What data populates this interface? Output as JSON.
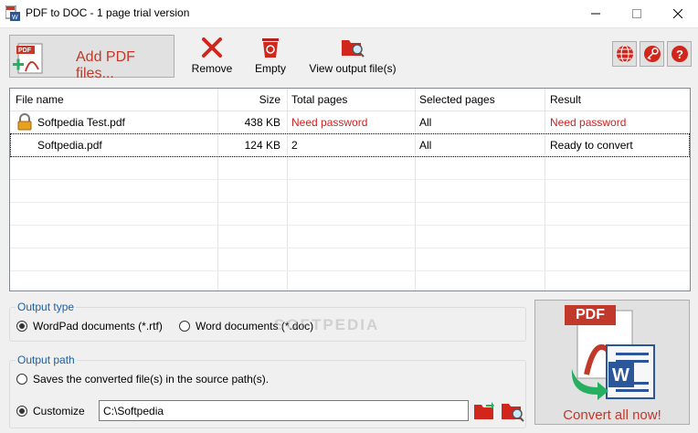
{
  "window": {
    "title": "PDF to DOC - 1 page trial version"
  },
  "toolbar": {
    "add_label": "Add PDF files...",
    "remove_label": "Remove",
    "empty_label": "Empty",
    "view_label": "View output file(s)",
    "small_buttons": [
      "globe-icon",
      "key-icon",
      "help-icon"
    ]
  },
  "table": {
    "columns": [
      "File name",
      "Size",
      "Total pages",
      "Selected pages",
      "Result"
    ],
    "rows": [
      {
        "name": "Softpedia Test.pdf",
        "size": "438 KB",
        "total": "Need password",
        "selected": "All",
        "result": "Need password",
        "locked": true
      },
      {
        "name": "Softpedia.pdf",
        "size": "124 KB",
        "total": "2",
        "selected": "All",
        "result": "Ready to convert",
        "locked": false
      }
    ]
  },
  "output_type": {
    "title": "Output type",
    "option1": "WordPad documents (*.rtf)",
    "option2": "Word documents (*.doc)",
    "selected": "option1"
  },
  "output_path": {
    "title": "Output path",
    "option1": "Saves the converted file(s) in the source path(s).",
    "option2": "Customize",
    "value": "C:\\Softpedia",
    "selected": "option2"
  },
  "convert": {
    "label": "Convert all now!",
    "badge": "PDF"
  },
  "watermark": "SOFTPEDIA",
  "colors": {
    "accent_red": "#c0392b",
    "group_title_blue": "#1c5fa8"
  }
}
